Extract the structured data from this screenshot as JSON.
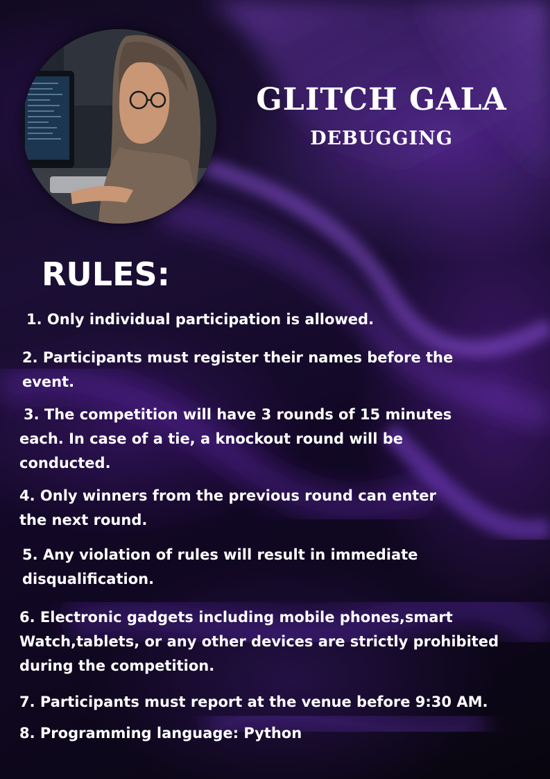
{
  "poster": {
    "title": "GLITCH GALA",
    "subtitle": "DEBUGGING",
    "rules_heading": "RULES:",
    "rules": [
      "1. Only individual participation is allowed.",
      "2. Participants must register their names before the\nevent.",
      "3. The competition will have 3 rounds of 15 minutes\neach. In case of a tie, a knockout round will be\nconducted.",
      "4. Only winners from the previous round can enter\nthe next round.",
      "5. Any violation of rules will result in immediate\ndisqualification.",
      "6. Electronic gadgets including mobile phones,smart\nWatch,tablets, or any other devices are strictly prohibited\nduring the competition.",
      "7. Participants must report at the venue before 9:30 AM.",
      "8. Programming language: Python"
    ]
  },
  "colors": {
    "background": "#120a22",
    "accent_purple": "#7a3fd0",
    "text": "#ffffff"
  }
}
